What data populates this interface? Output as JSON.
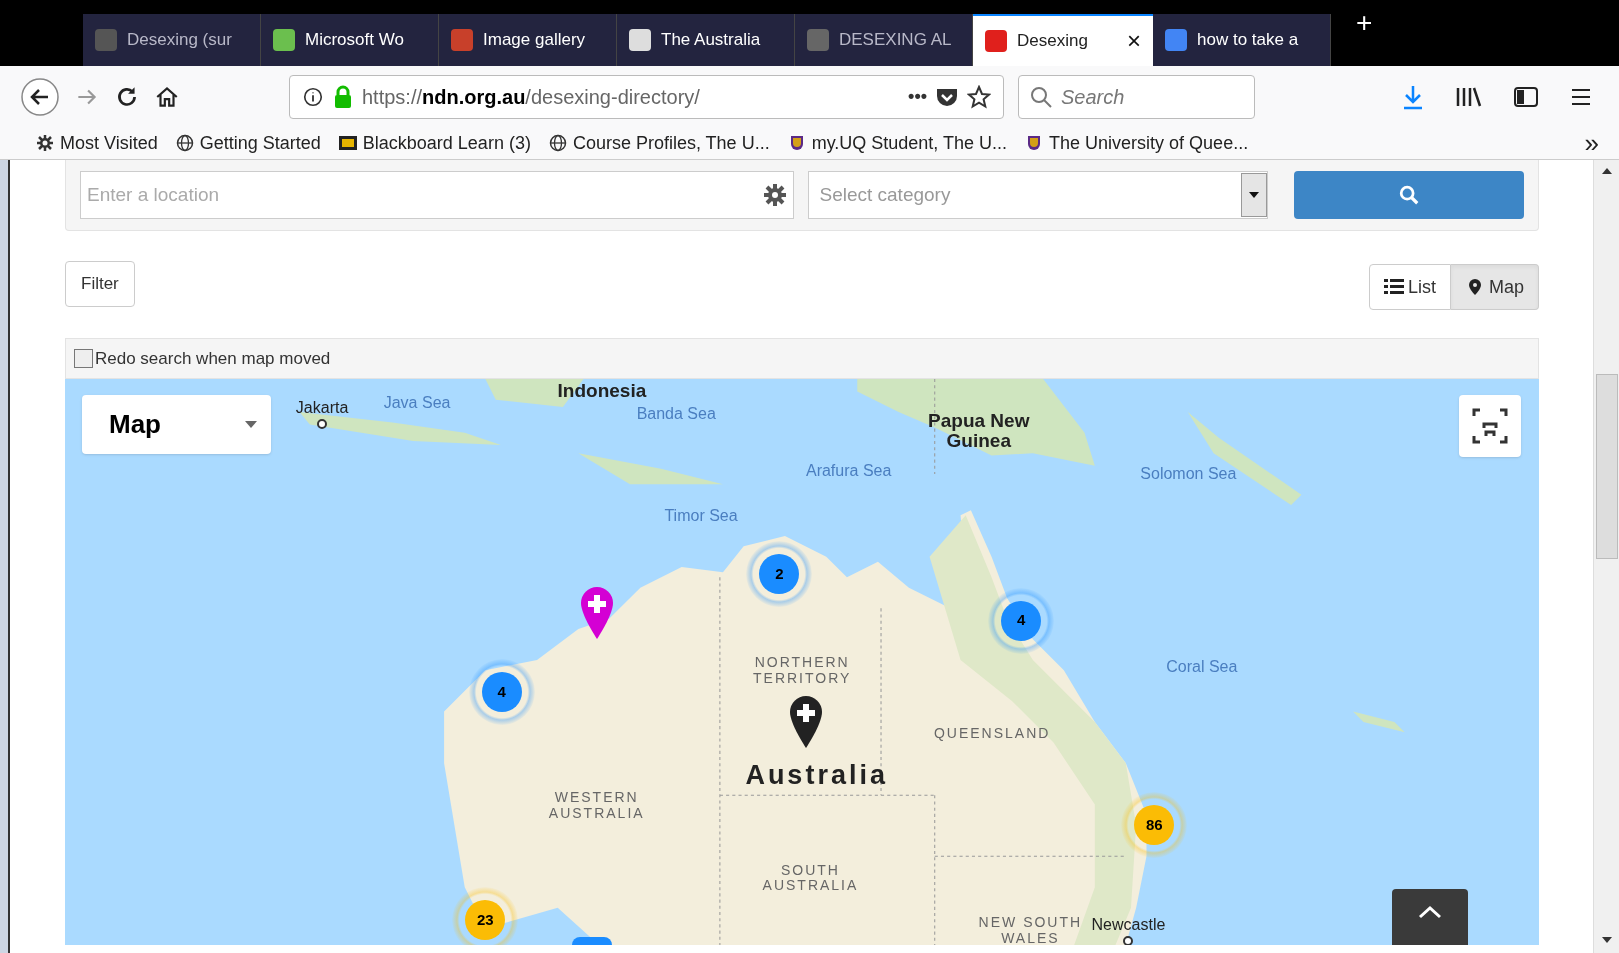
{
  "tabs": [
    {
      "title": "Desexing (sur",
      "selected": false,
      "faded": true,
      "color": "#555555"
    },
    {
      "title": "Microsoft Wo",
      "selected": false,
      "faded": false,
      "color": "#6bbf4e"
    },
    {
      "title": "Image gallery",
      "selected": false,
      "faded": false,
      "color": "#c8402a"
    },
    {
      "title": "The Australia",
      "selected": false,
      "faded": false,
      "color": "#dddddd"
    },
    {
      "title": "DESEXING AL",
      "selected": false,
      "faded": true,
      "color": "#666666"
    },
    {
      "title": "Desexing",
      "selected": true,
      "faded": false,
      "color": "#e0201c"
    },
    {
      "title": "how to take a",
      "selected": false,
      "faded": false,
      "color": "#4285f4"
    }
  ],
  "tab_close": "×",
  "new_tab": "+",
  "address": {
    "url": "https://**ndn.org.au**/desexing-directory/",
    "more": "•••"
  },
  "search": {
    "placeholder": "Search"
  },
  "bookmarks": [
    {
      "label": "Most Visited",
      "kind": "gear"
    },
    {
      "label": "Getting Started",
      "kind": "globe"
    },
    {
      "label": "Blackboard Learn (3)",
      "kind": "bb"
    },
    {
      "label": "Course Profiles, The U...",
      "kind": "globe"
    },
    {
      "label": "my.UQ Student, The U...",
      "kind": "crest"
    },
    {
      "label": "The University of Quee...",
      "kind": "crest"
    }
  ],
  "bookmarks_more": "»",
  "location_field": {
    "placeholder": "Enter a location"
  },
  "category_select": {
    "placeholder": "Select category"
  },
  "filter_button": "Filter",
  "view_toggle": [
    {
      "label": "List",
      "kind": "list",
      "selected": false
    },
    {
      "label": "Map",
      "kind": "pin",
      "selected": true
    }
  ],
  "redo_search": {
    "label": "Redo search when map moved",
    "checked": false
  },
  "map": {
    "map_type": "Map",
    "labels": [
      {
        "text": "Indonesia",
        "kind": "country"
      },
      {
        "text": "Jakarta",
        "kind": "city"
      },
      {
        "text": "Java Sea",
        "kind": "sea"
      },
      {
        "text": "Banda Sea",
        "kind": "sea"
      },
      {
        "text": "Papua New Guinea",
        "kind": "country"
      },
      {
        "text": "Arafura Sea",
        "kind": "sea"
      },
      {
        "text": "Solomon Sea",
        "kind": "sea"
      },
      {
        "text": "Timor Sea",
        "kind": "sea"
      },
      {
        "text": "Coral Sea",
        "kind": "sea"
      },
      {
        "text": "NORTHERN TERRITORY",
        "kind": "region"
      },
      {
        "text": "QUEENSLAND",
        "kind": "region"
      },
      {
        "text": "Australia",
        "kind": "continent"
      },
      {
        "text": "WESTERN AUSTRALIA",
        "kind": "region"
      },
      {
        "text": "SOUTH AUSTRALIA",
        "kind": "region"
      },
      {
        "text": "NEW SOUTH WALES",
        "kind": "region"
      },
      {
        "text": "Newcastle",
        "kind": "city"
      }
    ],
    "clusters": [
      {
        "count": "2",
        "color": "#1a8cff"
      },
      {
        "count": "4",
        "color": "#1a8cff"
      },
      {
        "count": "4",
        "color": "#1a8cff"
      },
      {
        "count": "86",
        "color": "#fbbc05"
      },
      {
        "count": "23",
        "color": "#fbbc05"
      }
    ],
    "pins": [
      {
        "color": "#d400d4"
      },
      {
        "color": "#222222"
      }
    ]
  }
}
